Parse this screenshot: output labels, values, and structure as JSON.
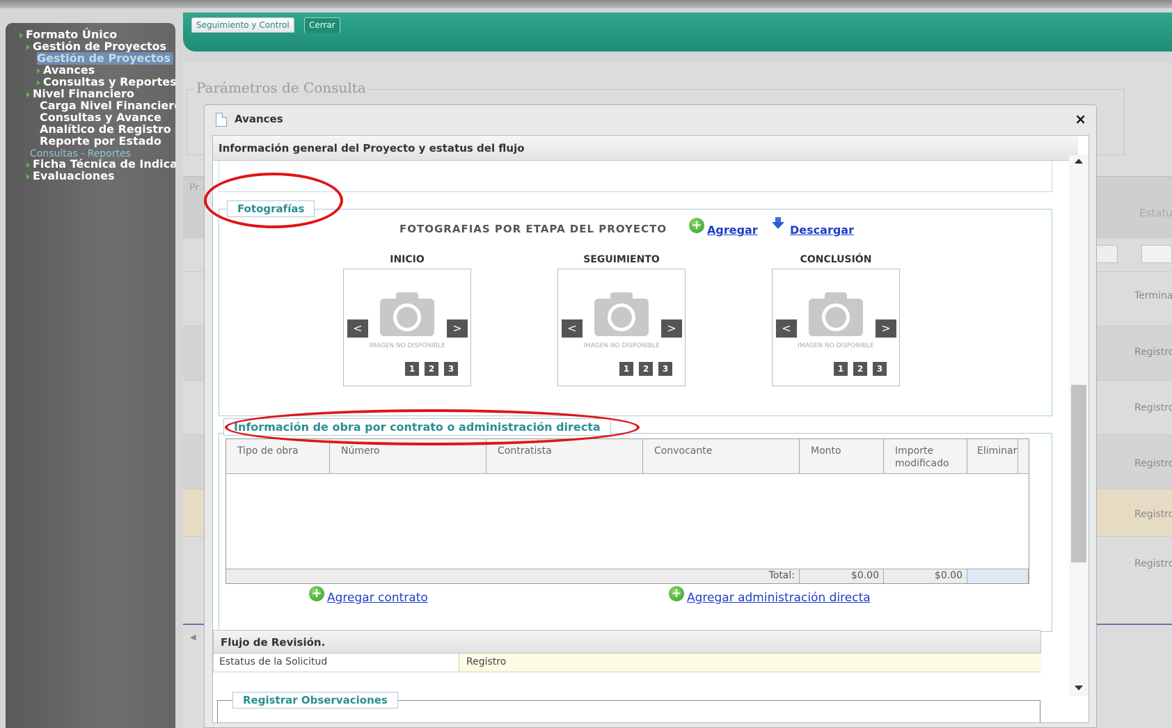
{
  "sidebar": {
    "items": [
      {
        "label": "Formato Único"
      },
      {
        "label": "Gestión de Proyectos"
      },
      {
        "label": "Gestión de Proyectos"
      },
      {
        "label": "Avances"
      },
      {
        "label": "Consultas y Reportes"
      },
      {
        "label": "Nivel Financiero"
      },
      {
        "label": "Carga Nivel Financiero"
      },
      {
        "label": "Consultas y Avance"
      },
      {
        "label": "Analítico de Registro"
      },
      {
        "label": "Reporte por Estado"
      },
      {
        "label": "Consultas - Reportes"
      },
      {
        "label": "Ficha Técnica de Indicadores"
      },
      {
        "label": "Evaluaciones"
      }
    ]
  },
  "header": {
    "tabs": [
      {
        "label": "Seguimiento y Control"
      },
      {
        "label": "Cerrar"
      }
    ]
  },
  "background": {
    "param_legend": "Parámetros de Consulta",
    "grid_prefix": "Pr",
    "estatus_head": "Estatu",
    "status_rows": [
      "Termina",
      "Registro",
      "Registro",
      "Registro",
      "Registro",
      "Registro"
    ],
    "row_highlight_color": "#fbefd2"
  },
  "modal": {
    "title": "Avances",
    "close": "×",
    "section_title": "Información general del Proyecto y estatus del flujo",
    "fotos": {
      "legend": "Fotografías",
      "header": "FOTOGRAFIAS POR ETAPA DEL PROYECTO",
      "add_label": "Agregar",
      "download_label": "Descargar",
      "stages": [
        {
          "label": "INICIO"
        },
        {
          "label": "SEGUIMIENTO"
        },
        {
          "label": "CONCLUSIÓN"
        }
      ],
      "no_image": "IMAGEN NO DISPONIBLE",
      "prev": "<",
      "next": ">",
      "pages": [
        "1",
        "2",
        "3"
      ]
    },
    "obra": {
      "legend": "Información de obra por contrato o administración directa",
      "columns": [
        "Tipo de obra",
        "Número",
        "Contratista",
        "Convocante",
        "Monto",
        "Importe modificado",
        "Eliminar"
      ],
      "total_label": "Total:",
      "total_monto": "$0.00",
      "total_importe": "$0.00",
      "add_contract": "Agregar contrato",
      "add_admin": "Agregar administración directa"
    },
    "flujo": {
      "title": "Flujo de Revisión.",
      "status_label": "Estatus de la Solicitud",
      "status_value": "Registro",
      "obs_legend": "Registrar Observaciones"
    }
  },
  "colors": {
    "accent_green": "#1f8c74",
    "link_blue": "#1e3ec8",
    "annotation_red": "#e01515"
  }
}
